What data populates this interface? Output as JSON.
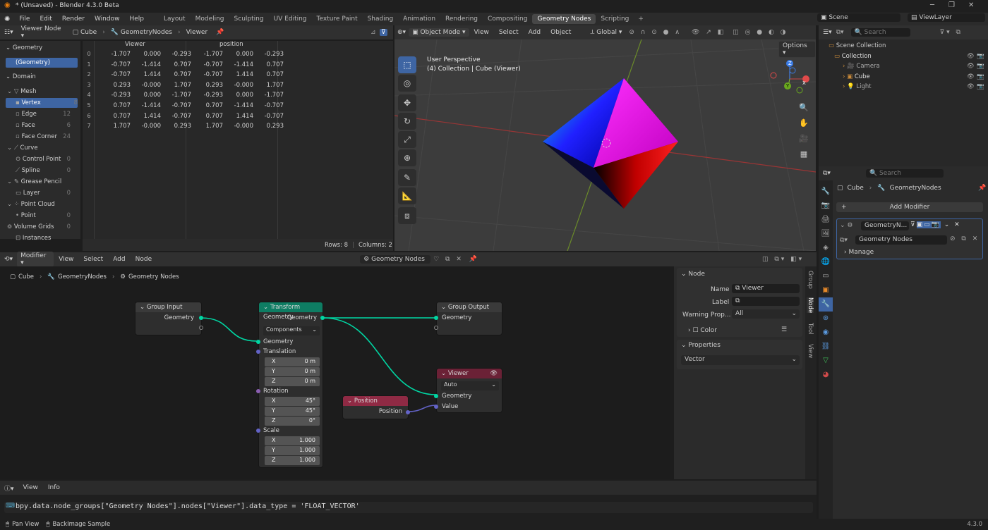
{
  "window": {
    "title": "* (Unsaved) - Blender 4.3.0 Beta"
  },
  "menu": [
    "File",
    "Edit",
    "Render",
    "Window",
    "Help"
  ],
  "workspaces": [
    "Layout",
    "Modeling",
    "Sculpting",
    "UV Editing",
    "Texture Paint",
    "Shading",
    "Animation",
    "Rendering",
    "Compositing",
    "Geometry Nodes",
    "Scripting"
  ],
  "active_workspace": "Geometry Nodes",
  "scene": {
    "scene_label": "Scene",
    "viewlayer_label": "ViewLayer"
  },
  "spreadsheet": {
    "header": {
      "mode": "Viewer Node",
      "object": "Cube",
      "modifier": "GeometryNodes",
      "node": "Viewer"
    },
    "tree": {
      "geometry_heading": "Geometry",
      "geometry_item": "(Geometry)",
      "domain_heading": "Domain",
      "items": [
        {
          "label": "Mesh",
          "count": ""
        },
        {
          "label": "Vertex",
          "count": "8"
        },
        {
          "label": "Edge",
          "count": "12"
        },
        {
          "label": "Face",
          "count": "6"
        },
        {
          "label": "Face Corner",
          "count": "24"
        },
        {
          "label": "Curve",
          "count": ""
        },
        {
          "label": "Control Point",
          "count": "0"
        },
        {
          "label": "Spline",
          "count": "0"
        },
        {
          "label": "Grease Pencil",
          "count": ""
        },
        {
          "label": "Layer",
          "count": "0"
        },
        {
          "label": "Point Cloud",
          "count": ""
        },
        {
          "label": "Point",
          "count": "0"
        },
        {
          "label": "Volume Grids",
          "count": "0"
        },
        {
          "label": "Instances",
          "count": ""
        }
      ]
    },
    "columns": [
      "Viewer",
      "position"
    ],
    "rows": [
      [
        "0",
        "-1.707",
        "0.000",
        "-0.293",
        "-1.707",
        "0.000",
        "-0.293"
      ],
      [
        "1",
        "-0.707",
        "-1.414",
        "0.707",
        "-0.707",
        "-1.414",
        "0.707"
      ],
      [
        "2",
        "-0.707",
        "1.414",
        "0.707",
        "-0.707",
        "1.414",
        "0.707"
      ],
      [
        "3",
        "0.293",
        "-0.000",
        "1.707",
        "0.293",
        "-0.000",
        "1.707"
      ],
      [
        "4",
        "-0.293",
        "0.000",
        "-1.707",
        "-0.293",
        "0.000",
        "-1.707"
      ],
      [
        "5",
        "0.707",
        "-1.414",
        "-0.707",
        "0.707",
        "-1.414",
        "-0.707"
      ],
      [
        "6",
        "0.707",
        "1.414",
        "-0.707",
        "0.707",
        "1.414",
        "-0.707"
      ],
      [
        "7",
        "1.707",
        "-0.000",
        "0.293",
        "1.707",
        "-0.000",
        "0.293"
      ]
    ],
    "footer": {
      "rows": "Rows: 8",
      "columns": "Columns: 2"
    }
  },
  "viewport": {
    "header": {
      "mode": "Object Mode",
      "menus": [
        "View",
        "Select",
        "Add",
        "Object"
      ],
      "orientation": "Global"
    },
    "overlay_title": "User Perspective",
    "overlay_sub": "(4) Collection | Cube (Viewer)",
    "options": "Options",
    "gizmo": {
      "x": "X",
      "y": "Y",
      "z": "Z"
    }
  },
  "node_editor": {
    "header": {
      "type": "Modifier",
      "menus": [
        "View",
        "Select",
        "Add",
        "Node"
      ],
      "tree": "Geometry Nodes"
    },
    "breadcrumb": [
      "Cube",
      "GeometryNodes",
      "Geometry Nodes"
    ],
    "nodes": {
      "group_input": {
        "title": "Group Input",
        "out": "Geometry"
      },
      "transform": {
        "title": "Transform Geometry",
        "out": "Geometry",
        "mode": "Components",
        "in_geometry": "Geometry",
        "translation": "Translation",
        "t": [
          [
            "X",
            "0 m"
          ],
          [
            "Y",
            "0 m"
          ],
          [
            "Z",
            "0 m"
          ]
        ],
        "rotation": "Rotation",
        "r": [
          [
            "X",
            "45°"
          ],
          [
            "Y",
            "45°"
          ],
          [
            "Z",
            "0°"
          ]
        ],
        "scale": "Scale",
        "s": [
          [
            "X",
            "1.000"
          ],
          [
            "Y",
            "1.000"
          ],
          [
            "Z",
            "1.000"
          ]
        ]
      },
      "group_output": {
        "title": "Group Output",
        "in": "Geometry"
      },
      "viewer": {
        "title": "Viewer",
        "mode": "Auto",
        "geometry": "Geometry",
        "value": "Value"
      },
      "position": {
        "title": "Position",
        "out": "Position"
      }
    }
  },
  "node_sidebar": {
    "node_section": "Node",
    "name_label": "Name",
    "name_value": "Viewer",
    "label_label": "Label",
    "label_value": "",
    "warning_label": "Warning Prop...",
    "warning_value": "All",
    "color_label": "Color",
    "properties_section": "Properties",
    "data_type": "Vector",
    "tabs": [
      "Group",
      "Node",
      "Tool",
      "View"
    ]
  },
  "outliner": {
    "search_placeholder": "Search",
    "items": [
      {
        "label": "Scene Collection"
      },
      {
        "label": "Collection"
      },
      {
        "label": "Camera"
      },
      {
        "label": "Cube"
      },
      {
        "label": "Light"
      }
    ]
  },
  "properties": {
    "search_placeholder": "Search",
    "breadcrumb": [
      "Cube",
      "GeometryNodes"
    ],
    "add_modifier": "Add Modifier",
    "modifier_name": "GeometryN...",
    "node_group": "Geometry Nodes",
    "manage": "Manage"
  },
  "info": {
    "menus": [
      "View",
      "Info"
    ],
    "log": "bpy.data.node_groups[\"Geometry Nodes\"].nodes[\"Viewer\"].data_type = 'FLOAT_VECTOR'"
  },
  "statusbar": {
    "left1": "Pan View",
    "left2": "BackImage Sample",
    "version": "4.3.0"
  },
  "colors": {
    "accent": "#3e65a3",
    "geometry_socket": "#00d6a3",
    "vector_socket": "#6363c7",
    "transform_header": "#0e7d63",
    "viewer_header": "#6b2136",
    "position_header": "#8f2a44"
  }
}
